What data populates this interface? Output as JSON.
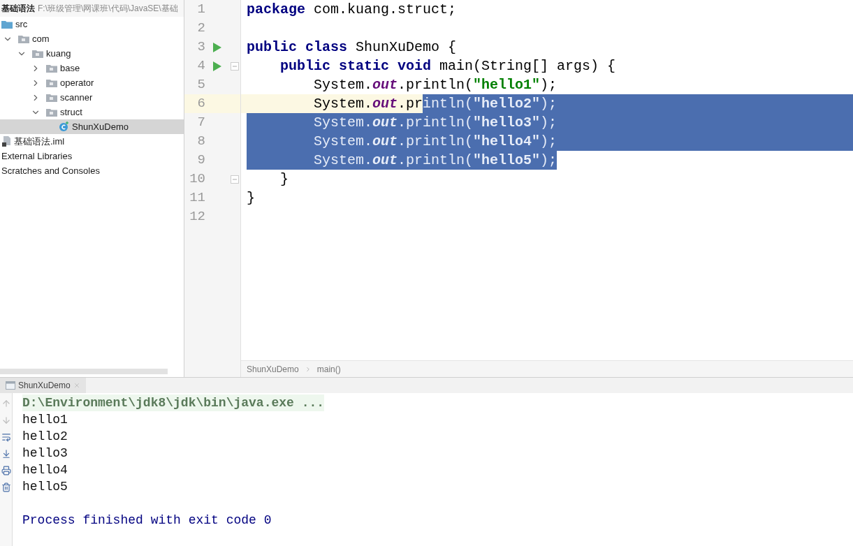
{
  "project_header": {
    "name": "基础语法",
    "path": "F:\\班级管理\\网课班\\代码\\JavaSE\\基础"
  },
  "tree": [
    {
      "label": "src",
      "kind": "source_folder",
      "selected": false,
      "children": [
        {
          "label": "com",
          "kind": "package",
          "selected": false,
          "expanded": true,
          "children": [
            {
              "label": "kuang",
              "kind": "package",
              "selected": false,
              "expanded": true,
              "children": [
                {
                  "label": "base",
                  "kind": "package",
                  "selected": false,
                  "expanded": false
                },
                {
                  "label": "operator",
                  "kind": "package",
                  "selected": false,
                  "expanded": false
                },
                {
                  "label": "scanner",
                  "kind": "package",
                  "selected": false,
                  "expanded": false
                },
                {
                  "label": "struct",
                  "kind": "package",
                  "selected": false,
                  "expanded": true,
                  "children": [
                    {
                      "label": "ShunXuDemo",
                      "kind": "class",
                      "selected": true
                    }
                  ]
                }
              ]
            }
          ]
        }
      ]
    },
    {
      "label": "基础语法.iml",
      "kind": "module_file",
      "selected": false
    },
    {
      "label": "External Libraries",
      "kind": "plain",
      "selected": false
    },
    {
      "label": "Scratches and Consoles",
      "kind": "plain",
      "selected": false
    }
  ],
  "editor": {
    "lines": [
      {
        "number": "1",
        "tokens": [
          {
            "text": "package",
            "kind": "keyword",
            "selected": false
          },
          {
            "text": " com.kuang.struct;",
            "kind": "plain",
            "selected": false
          }
        ]
      },
      {
        "number": "2"
      },
      {
        "number": "3",
        "run": true,
        "tokens": [
          {
            "text": "public class",
            "kind": "keyword",
            "selected": false
          },
          {
            "text": " ShunXuDemo {",
            "kind": "plain",
            "selected": false
          }
        ]
      },
      {
        "number": "4",
        "run": true,
        "fold": true,
        "tokens": [
          {
            "text": "    public static void",
            "kind": "keyword",
            "selected": false
          },
          {
            "text": " main(String[] args) {",
            "kind": "plain",
            "selected": false
          }
        ]
      },
      {
        "number": "5",
        "tokens": [
          {
            "text": "        System.",
            "kind": "plain",
            "selected": false
          },
          {
            "text": "out",
            "kind": "field",
            "selected": false
          },
          {
            "text": ".println(",
            "kind": "plain",
            "selected": false
          },
          {
            "text": "\"hello1\"",
            "kind": "string",
            "selected": false
          },
          {
            "text": ");",
            "kind": "plain",
            "selected": false
          }
        ]
      },
      {
        "number": "6",
        "current": true,
        "selection_to_edge": true,
        "tokens": [
          {
            "text": "        System.",
            "kind": "plain",
            "selected": false
          },
          {
            "text": "out",
            "kind": "field",
            "selected": false
          },
          {
            "text": ".pr",
            "kind": "plain",
            "selected": false
          },
          {
            "text": "intln(",
            "kind": "plain",
            "selected": true
          },
          {
            "text": "\"hello2\"",
            "kind": "string",
            "selected": true
          },
          {
            "text": ");",
            "kind": "plain",
            "selected": true
          }
        ]
      },
      {
        "number": "7",
        "selection_to_edge": true,
        "tokens": [
          {
            "text": "        System.",
            "kind": "plain",
            "selected": true
          },
          {
            "text": "out",
            "kind": "field",
            "selected": true
          },
          {
            "text": ".println(",
            "kind": "plain",
            "selected": true
          },
          {
            "text": "\"hello3\"",
            "kind": "string",
            "selected": true
          },
          {
            "text": ");",
            "kind": "plain",
            "selected": true
          }
        ]
      },
      {
        "number": "8",
        "selection_to_edge": true,
        "tokens": [
          {
            "text": "        System.",
            "kind": "plain",
            "selected": true
          },
          {
            "text": "out",
            "kind": "field",
            "selected": true
          },
          {
            "text": ".println(",
            "kind": "plain",
            "selected": true
          },
          {
            "text": "\"hello4\"",
            "kind": "string",
            "selected": true
          },
          {
            "text": ");",
            "kind": "plain",
            "selected": true
          }
        ]
      },
      {
        "number": "9",
        "tokens": [
          {
            "text": "        System.",
            "kind": "plain",
            "selected": true
          },
          {
            "text": "out",
            "kind": "field",
            "selected": true
          },
          {
            "text": ".println(",
            "kind": "plain",
            "selected": true
          },
          {
            "text": "\"hello5\"",
            "kind": "string",
            "selected": true
          },
          {
            "text": ");",
            "kind": "plain",
            "selected": true
          }
        ]
      },
      {
        "number": "10",
        "fold": true,
        "tokens": [
          {
            "text": "    }",
            "kind": "plain",
            "selected": false
          }
        ]
      },
      {
        "number": "11",
        "tokens": [
          {
            "text": "}",
            "kind": "plain",
            "selected": false
          }
        ]
      },
      {
        "number": "12"
      }
    ],
    "breadcrumbs": [
      "ShunXuDemo",
      "main()"
    ]
  },
  "run_panel": {
    "tab": {
      "label": "ShunXuDemo",
      "selected": true
    },
    "lines": [
      {
        "text": "D:\\Environment\\jdk8\\jdk\\bin\\java.exe ...",
        "kind": "command"
      },
      {
        "text": "hello1",
        "kind": "output"
      },
      {
        "text": "hello2",
        "kind": "output"
      },
      {
        "text": "hello3",
        "kind": "output"
      },
      {
        "text": "hello4",
        "kind": "output"
      },
      {
        "text": "hello5",
        "kind": "output"
      },
      {
        "text": "Process finished with exit code 0",
        "kind": "exit"
      }
    ]
  }
}
